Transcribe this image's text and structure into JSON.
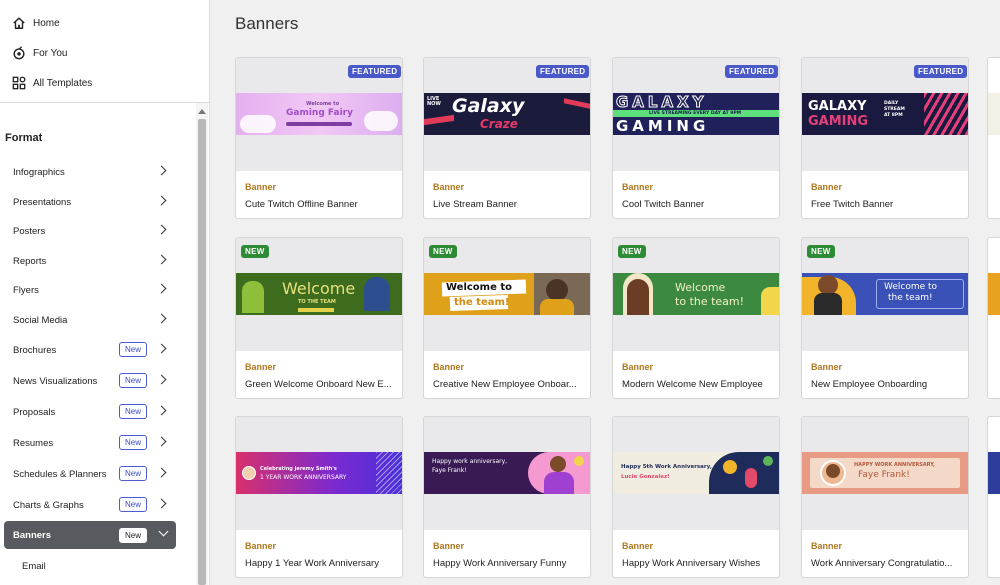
{
  "sidebar": {
    "top_nav": [
      {
        "label": "Home",
        "icon": "home-icon"
      },
      {
        "label": "For You",
        "icon": "for-you-icon"
      },
      {
        "label": "All Templates",
        "icon": "grid-icon"
      }
    ],
    "format_heading": "Format",
    "formats": [
      {
        "label": "Infographics",
        "badge": ""
      },
      {
        "label": "Presentations",
        "badge": ""
      },
      {
        "label": "Posters",
        "badge": ""
      },
      {
        "label": "Reports",
        "badge": ""
      },
      {
        "label": "Flyers",
        "badge": ""
      },
      {
        "label": "Social Media",
        "badge": ""
      },
      {
        "label": "Brochures",
        "badge": "New"
      },
      {
        "label": "News Visualizations",
        "badge": "New"
      },
      {
        "label": "Proposals",
        "badge": "New"
      },
      {
        "label": "Resumes",
        "badge": "New"
      },
      {
        "label": "Schedules & Planners",
        "badge": "New"
      },
      {
        "label": "Charts & Graphs",
        "badge": "New"
      },
      {
        "label": "Banners",
        "badge": "New",
        "active": true
      }
    ],
    "sub_item": "Email"
  },
  "main": {
    "title": "Banners",
    "cards": [
      {
        "badge": "FEATURED",
        "category": "Banner",
        "name": "Cute Twitch Offline Banner",
        "art": {
          "bg": "#e6b8f0",
          "text1": "Welcome to",
          "text2": "Gaming Fairy"
        }
      },
      {
        "badge": "FEATURED",
        "category": "Banner",
        "name": "Live Stream Banner",
        "art": {
          "bg": "#1c1c3a",
          "text1": "LIVE NOW",
          "text2": "Galaxy",
          "text3": "Craze"
        }
      },
      {
        "badge": "FEATURED",
        "category": "Banner",
        "name": "Cool Twitch Banner",
        "art": {
          "bg": "#20205a",
          "text1": "GALAXY",
          "text2": "LIVE STREAMING EVERY DAY AT 9PM",
          "text3": "GAMING"
        }
      },
      {
        "badge": "FEATURED",
        "category": "Banner",
        "name": "Free Twitch Banner",
        "art": {
          "bg": "#1a1a40",
          "text1": "GALAXY",
          "text2": "GAMING",
          "text3": "DAILY STREAM AT 8PM"
        }
      },
      {
        "badge": "NEW",
        "category": "Banner",
        "name": "Green Welcome Onboard New E...",
        "art": {
          "bg": "#3f6e1e",
          "text1": "Welcome",
          "text2": "TO THE TEAM"
        }
      },
      {
        "badge": "NEW",
        "category": "Banner",
        "name": "Creative New Employee Onboar...",
        "art": {
          "bg": "#e1a21a",
          "text1": "Welcome to",
          "text2": "the team!"
        }
      },
      {
        "badge": "NEW",
        "category": "Banner",
        "name": "Modern Welcome New Employee",
        "art": {
          "bg": "#3b8a3f",
          "text1": "Welcome",
          "text2": "to the team!"
        }
      },
      {
        "badge": "NEW",
        "category": "Banner",
        "name": "New Employee Onboarding",
        "art": {
          "bg": "#3a52b8",
          "text1": "Welcome to",
          "text2": "the team!"
        }
      },
      {
        "badge": "",
        "category": "Banner",
        "name": "Happy 1 Year Work Anniversary",
        "art": {
          "bg": "#5a2fc0",
          "text1": "Celebrating Jeremy Smith's",
          "text2": "1 YEAR WORK ANNIVERSARY"
        }
      },
      {
        "badge": "",
        "category": "Banner",
        "name": "Happy Work Anniversary Funny",
        "art": {
          "bg": "#3a1a54",
          "text1": "Happy work anniversary,",
          "text2": "Faye Frank!"
        }
      },
      {
        "badge": "",
        "category": "Banner",
        "name": "Happy Work Anniversary Wishes",
        "art": {
          "bg": "#f1ece0",
          "text1": "Happy 5th Work Anniversary,",
          "text2": "Lucie Gonzalez!"
        }
      },
      {
        "badge": "",
        "category": "Banner",
        "name": "Work Anniversary Congratulatio...",
        "art": {
          "bg": "#e79a84",
          "text1": "HAPPY WORK ANNIVERSARY,",
          "text2": "Faye Frank!"
        }
      }
    ]
  }
}
